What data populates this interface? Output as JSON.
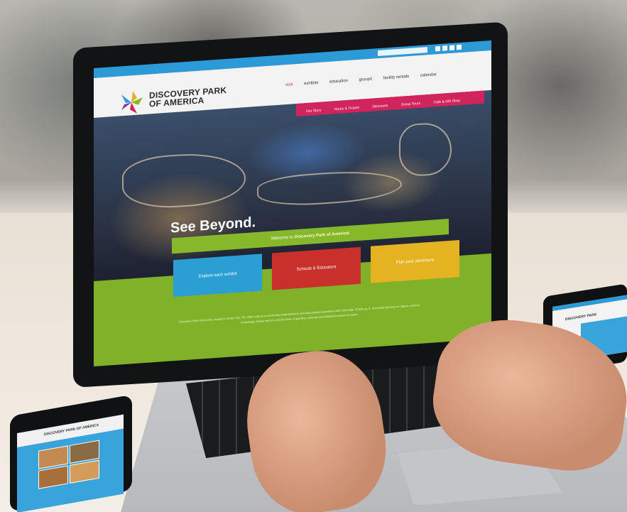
{
  "site": {
    "logo_line1": "DISCOVERY PARK",
    "logo_line2": "OF AMERICA",
    "nav": [
      "visit",
      "exhibits",
      "education",
      "groups",
      "facility rentals",
      "calendar"
    ],
    "subnav": [
      "Our Story",
      "Hours & Tickets",
      "Discounts",
      "Group Tours",
      "Cafe & Gift Shop"
    ],
    "hero_headline": "See Beyond.",
    "welcome_prefix": "Welcome to",
    "welcome_name": "Discovery Park of America!",
    "tiles": [
      "Explore each exhibit",
      "Schools & Educators",
      "Plan your adventure"
    ],
    "about": "Discovery Park of America, located in Union City, TN, offers visitors a world-class entertainment and educational experience with more than 70,000 sq. ft. of exhibits focused on nature, science, technology, history and art, and 50 acres of gardens, grounds and exhibits focused on nature."
  },
  "phone": {
    "title": "DISCOVERY PARK OF AMERICA"
  },
  "tablet": {
    "title": "DISCOVERY PARK"
  },
  "colors": {
    "topbar": "#2d9ad8",
    "accent_pink": "#d1245d",
    "green": "#86b82b",
    "tile_blue": "#2b9fd4",
    "tile_red": "#c9302c",
    "tile_yellow": "#e5b321"
  }
}
